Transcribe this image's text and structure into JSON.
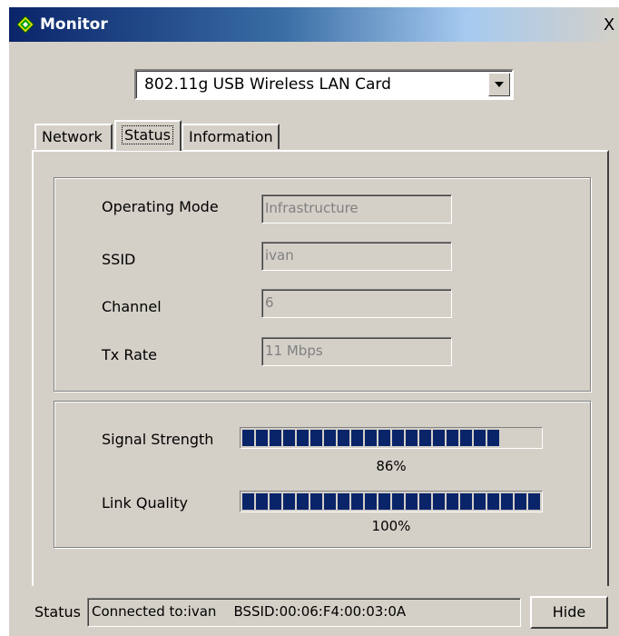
{
  "window": {
    "title": "Monitor",
    "close_symbol": "X"
  },
  "adapter_select": {
    "value": "802.11g USB Wireless LAN Card"
  },
  "tabs": [
    {
      "label": "Network",
      "active": false
    },
    {
      "label": "Status",
      "active": true
    },
    {
      "label": "Information",
      "active": false
    }
  ],
  "status_info": {
    "operating_mode": {
      "label": "Operating Mode",
      "value": "Infrastructure"
    },
    "ssid": {
      "label": "SSID",
      "value": "ivan"
    },
    "channel": {
      "label": "Channel",
      "value": "6"
    },
    "tx_rate": {
      "label": "Tx Rate",
      "value": "11 Mbps"
    }
  },
  "signal": {
    "signal_strength": {
      "label": "Signal Strength",
      "percent": 86,
      "text": "86%"
    },
    "link_quality": {
      "label": "Link Quality",
      "percent": 100,
      "text": "100%"
    }
  },
  "footer": {
    "status_label": "Status",
    "status_text": "Connected to:ivan    BSSID:00:06:F4:00:03:0A",
    "hide_label": "Hide"
  },
  "colors": {
    "bar_fill": "#0a246a",
    "face": "#d4d0c8",
    "title_start": "#0a246a"
  },
  "icons": {
    "title": "diamond-app-icon",
    "dropdown": "triangle-down-icon",
    "close": "close-icon"
  }
}
